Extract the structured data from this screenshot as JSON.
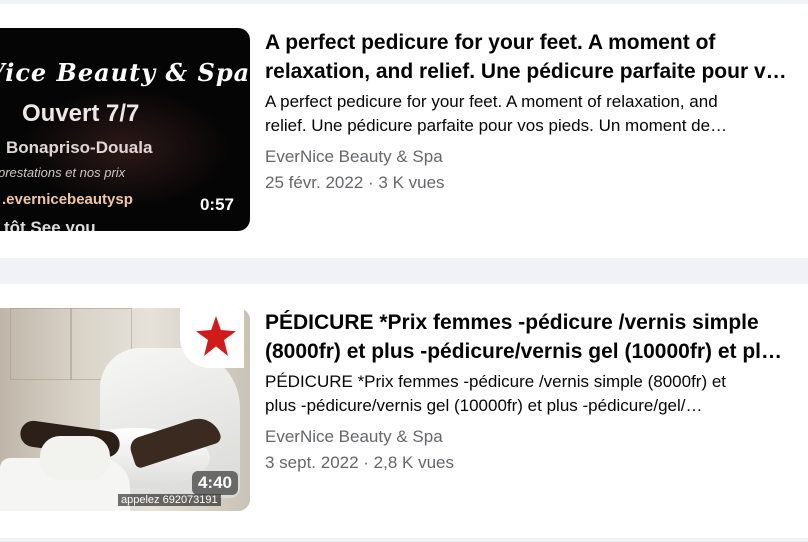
{
  "videos": [
    {
      "title_line1": "A perfect pedicure for your feet. A moment of",
      "title_line2": "relaxation, and relief. Une pédicure parfaite pour v…",
      "desc_line1": "A perfect pedicure for your feet. A moment of relaxation, and",
      "desc_line2": "relief. Une pédicure parfaite pour vos pieds. Un moment de…",
      "channel": "EverNice Beauty & Spa",
      "date_views": "25 févr. 2022 · 3 K vues",
      "duration": "0:57",
      "thumb": {
        "brand": "Vice Beauty & Spa",
        "open": "Ouvert 7/7",
        "city": "Bonapriso-Douala",
        "presta": "prestations et nos prix",
        "url": ".evernicebeautysp",
        "bottom": "tôt     See you"
      }
    },
    {
      "title_line1": "PÉDICURE *Prix femmes -pédicure /vernis simple",
      "title_line2": "(8000fr) et plus -pédicure/vernis gel (10000fr) et pl…",
      "desc_line1": "PÉDICURE *Prix femmes -pédicure /vernis simple (8000fr) et",
      "desc_line2": "plus -pédicure/vernis gel (10000fr) et plus -pédicure/gel/…",
      "channel": "EverNice Beauty & Spa",
      "date_views": "3 sept. 2022 · 2,8 K vues",
      "duration": "4:40",
      "thumb": {
        "phone": "appelez 692073191"
      }
    }
  ],
  "colors": {
    "page_bg": "#f0f2f5",
    "card_bg": "#ffffff",
    "text_primary": "#050505",
    "text_secondary": "#65676b"
  }
}
